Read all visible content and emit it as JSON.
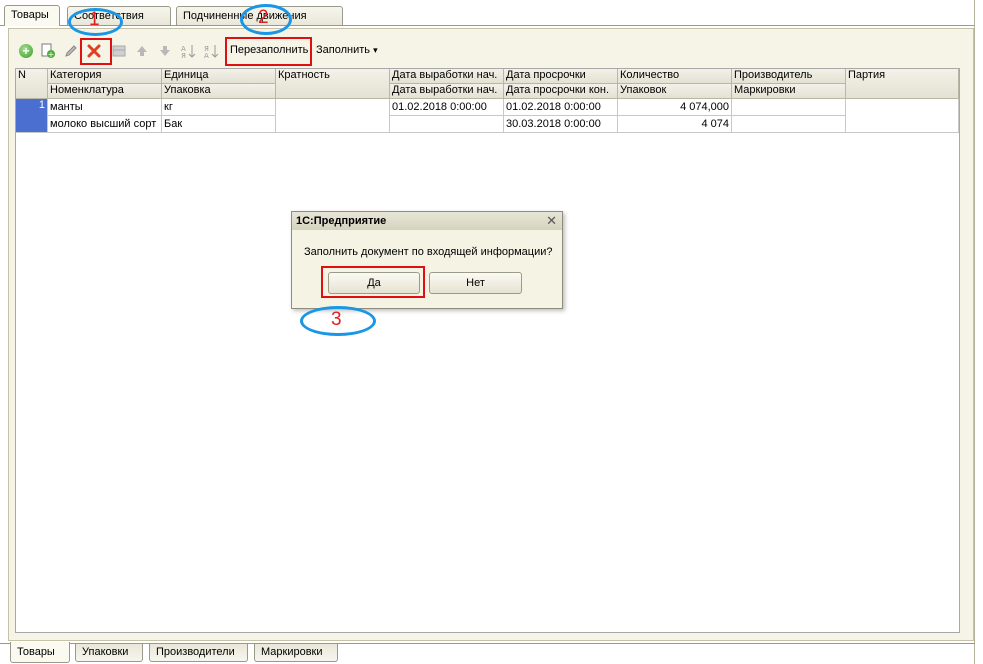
{
  "top_tabs": [
    "Товары",
    "Соответствия",
    "Подчиненные движения"
  ],
  "toolbar": {
    "add_icon": "add-icon",
    "copy_icon": "copy-icon",
    "edit_icon": "pencil-icon",
    "delete_icon": "delete-x-icon",
    "refill_label": "Перезаполнить",
    "fill_label": "Заполнить",
    "fill_arrow": "▾"
  },
  "grid": {
    "header_row1": [
      "N",
      "Категория",
      "Единица",
      "Кратность",
      "Дата выработки нач.",
      "Дата просрочки",
      "Количество",
      "Производитель",
      "Партия"
    ],
    "header_row2": [
      "Номенклатура",
      "Упаковка",
      "Дата выработки нач.",
      "Дата просрочки кон.",
      "Упаковок",
      "Маркировки"
    ],
    "rows": [
      {
        "n": "1",
        "category": "манты",
        "unit": "кг",
        "date_prod": "01.02.2018 0:00:00",
        "date_exp": "01.02.2018 0:00:00",
        "qty": "4 074,000",
        "nomenclature": "молоко высший сорт",
        "pack": "Бак",
        "date_prod_end": "",
        "date_exp_end": "30.03.2018 0:00:00",
        "packs": "4 074"
      }
    ]
  },
  "dialog": {
    "title": "1С:Предприятие",
    "message": "Заполнить документ по входящей информации?",
    "yes_label": "Да",
    "no_label": "Нет",
    "close_glyph": "✕"
  },
  "bottom_tabs": [
    "Товары",
    "Упаковки",
    "Производители",
    "Маркировки"
  ],
  "annotations": {
    "n1": "1",
    "n2": "2",
    "n3": "3"
  },
  "colors": {
    "annotation_red": "#e01010",
    "annotation_blue": "#1a96e6",
    "selection_blue": "#4a6fd0"
  }
}
